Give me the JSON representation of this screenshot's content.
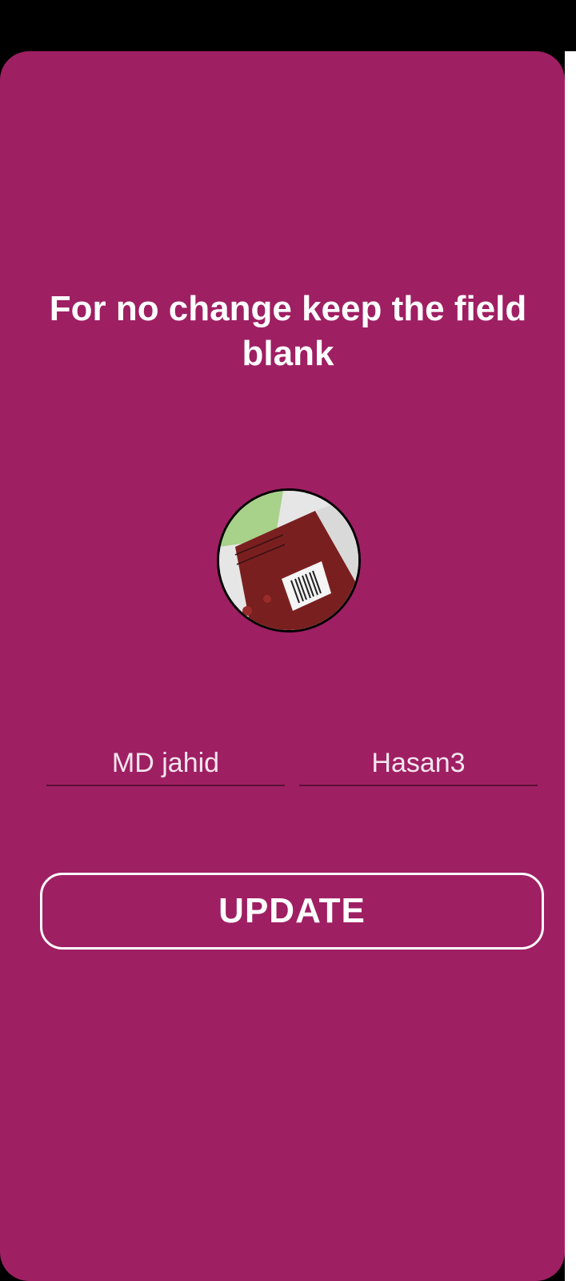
{
  "instructions": {
    "title": "For no change keep the field blank"
  },
  "profile": {
    "avatar_icon": "profile-photo"
  },
  "form": {
    "first_name_placeholder": "MD jahid",
    "last_name_placeholder": "Hasan3",
    "first_name_value": "",
    "last_name_value": ""
  },
  "actions": {
    "update_label": "UPDATE"
  },
  "colors": {
    "background": "#9f1f63",
    "text": "#ffffff",
    "status_bar": "#000000"
  }
}
